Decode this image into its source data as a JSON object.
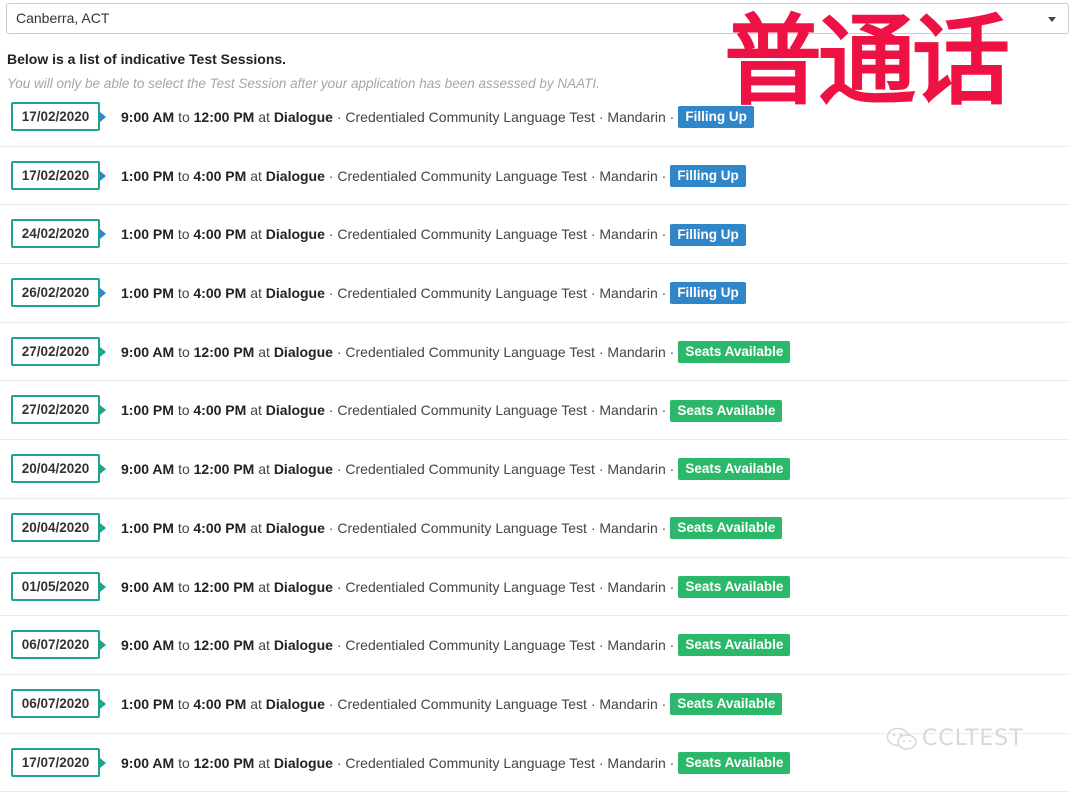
{
  "location": {
    "selected": "Canberra, ACT"
  },
  "intro": {
    "title": "Below is a list of indicative Test Sessions.",
    "note": "You will only be able to select the Test Session after your application has been assessed by NAATI."
  },
  "watermark": {
    "chinese_text": "普通话",
    "brand_text": "CCLTEST",
    "brand_icon": "wechat-icon"
  },
  "labels": {
    "to": "to",
    "at": "at",
    "separator": "·"
  },
  "colors": {
    "filling_up": "#2f86c8",
    "seats_available": "#2cb86a",
    "date_border": "#1fa38f",
    "watermark_red": "#ee1144"
  },
  "sessions": [
    {
      "date": "17/02/2020",
      "start": "9:00 AM",
      "end": "12:00 PM",
      "venue": "Dialogue",
      "test": "Credentialed Community Language Test",
      "language": "Mandarin",
      "status": "Filling Up",
      "status_type": "filling"
    },
    {
      "date": "17/02/2020",
      "start": "1:00 PM",
      "end": "4:00 PM",
      "venue": "Dialogue",
      "test": "Credentialed Community Language Test",
      "language": "Mandarin",
      "status": "Filling Up",
      "status_type": "filling"
    },
    {
      "date": "24/02/2020",
      "start": "1:00 PM",
      "end": "4:00 PM",
      "venue": "Dialogue",
      "test": "Credentialed Community Language Test",
      "language": "Mandarin",
      "status": "Filling Up",
      "status_type": "filling"
    },
    {
      "date": "26/02/2020",
      "start": "1:00 PM",
      "end": "4:00 PM",
      "venue": "Dialogue",
      "test": "Credentialed Community Language Test",
      "language": "Mandarin",
      "status": "Filling Up",
      "status_type": "filling"
    },
    {
      "date": "27/02/2020",
      "start": "9:00 AM",
      "end": "12:00 PM",
      "venue": "Dialogue",
      "test": "Credentialed Community Language Test",
      "language": "Mandarin",
      "status": "Seats Available",
      "status_type": "available"
    },
    {
      "date": "27/02/2020",
      "start": "1:00 PM",
      "end": "4:00 PM",
      "venue": "Dialogue",
      "test": "Credentialed Community Language Test",
      "language": "Mandarin",
      "status": "Seats Available",
      "status_type": "available"
    },
    {
      "date": "20/04/2020",
      "start": "9:00 AM",
      "end": "12:00 PM",
      "venue": "Dialogue",
      "test": "Credentialed Community Language Test",
      "language": "Mandarin",
      "status": "Seats Available",
      "status_type": "available"
    },
    {
      "date": "20/04/2020",
      "start": "1:00 PM",
      "end": "4:00 PM",
      "venue": "Dialogue",
      "test": "Credentialed Community Language Test",
      "language": "Mandarin",
      "status": "Seats Available",
      "status_type": "available"
    },
    {
      "date": "01/05/2020",
      "start": "9:00 AM",
      "end": "12:00 PM",
      "venue": "Dialogue",
      "test": "Credentialed Community Language Test",
      "language": "Mandarin",
      "status": "Seats Available",
      "status_type": "available"
    },
    {
      "date": "06/07/2020",
      "start": "9:00 AM",
      "end": "12:00 PM",
      "venue": "Dialogue",
      "test": "Credentialed Community Language Test",
      "language": "Mandarin",
      "status": "Seats Available",
      "status_type": "available"
    },
    {
      "date": "06/07/2020",
      "start": "1:00 PM",
      "end": "4:00 PM",
      "venue": "Dialogue",
      "test": "Credentialed Community Language Test",
      "language": "Mandarin",
      "status": "Seats Available",
      "status_type": "available"
    },
    {
      "date": "17/07/2020",
      "start": "9:00 AM",
      "end": "12:00 PM",
      "venue": "Dialogue",
      "test": "Credentialed Community Language Test",
      "language": "Mandarin",
      "status": "Seats Available",
      "status_type": "available"
    }
  ]
}
